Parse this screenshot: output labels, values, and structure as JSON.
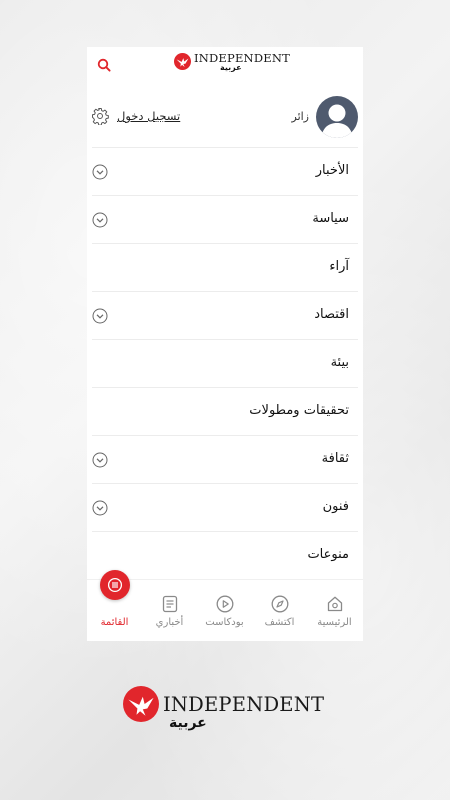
{
  "header": {
    "brand": "INDEPENDENT",
    "brand_sub": "عربية"
  },
  "user": {
    "visitor_label": "زائر",
    "login_label": "تسجيل دخول"
  },
  "menu": {
    "items": [
      {
        "label": "الأخبار",
        "expandable": true
      },
      {
        "label": "سياسة",
        "expandable": true
      },
      {
        "label": "آراء",
        "expandable": false
      },
      {
        "label": "اقتصاد",
        "expandable": true
      },
      {
        "label": "بيئة",
        "expandable": false
      },
      {
        "label": "تحقيقات ومطولات",
        "expandable": false
      },
      {
        "label": "ثقافة",
        "expandable": true
      },
      {
        "label": "فنون",
        "expandable": true
      },
      {
        "label": "منوعات",
        "expandable": false
      }
    ]
  },
  "bottom_nav": {
    "tabs": [
      {
        "label": "الرئيسية",
        "icon": "home-icon"
      },
      {
        "label": "اكتشف",
        "icon": "compass-icon"
      },
      {
        "label": "بودكاست",
        "icon": "play-icon"
      },
      {
        "label": "أخباري",
        "icon": "news-icon"
      },
      {
        "label": "القائمة",
        "icon": "menu-icon",
        "active": true
      }
    ]
  },
  "footer": {
    "brand": "INDEPENDENT",
    "brand_sub": "عربية"
  },
  "colors": {
    "accent": "#e1262c",
    "avatar": "#4f5a6e",
    "text": "#111111",
    "muted": "#8a8a8a"
  }
}
